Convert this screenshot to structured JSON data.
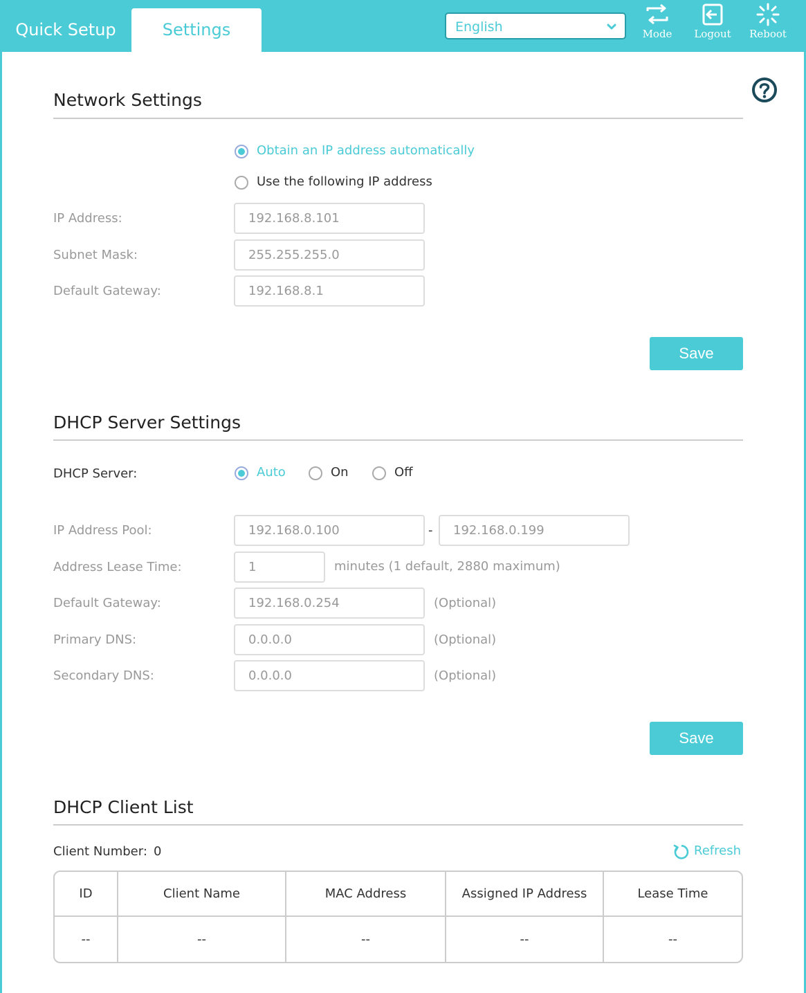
{
  "tabs": {
    "quick_setup": "Quick Setup",
    "settings": "Settings"
  },
  "language": {
    "selected": "English"
  },
  "toolbar": {
    "mode": "Mode",
    "logout": "Logout",
    "reboot": "Reboot"
  },
  "network": {
    "title": "Network Settings",
    "option_auto": "Obtain an IP address automatically",
    "option_manual": "Use the following IP address",
    "selected": "auto",
    "ip_label": "IP Address:",
    "ip_value": "192.168.8.101",
    "mask_label": "Subnet Mask:",
    "mask_value": "255.255.255.0",
    "gateway_label": "Default Gateway:",
    "gateway_value": "192.168.8.1",
    "save": "Save"
  },
  "dhcp": {
    "title": "DHCP Server Settings",
    "server_label": "DHCP Server:",
    "options": [
      "Auto",
      "On",
      "Off"
    ],
    "selected": "Auto",
    "pool_label": "IP Address Pool:",
    "pool_start": "192.168.0.100",
    "pool_sep": "-",
    "pool_end": "192.168.0.199",
    "lease_label": "Address Lease Time:",
    "lease_value": "1",
    "lease_hint": "minutes (1 default, 2880 maximum)",
    "gateway_label": "Default Gateway:",
    "gateway_value": "192.168.0.254",
    "primary_dns_label": "Primary DNS:",
    "primary_dns_value": "0.0.0.0",
    "secondary_dns_label": "Secondary DNS:",
    "secondary_dns_value": "0.0.0.0",
    "optional": "(Optional)",
    "save": "Save"
  },
  "clients": {
    "title": "DHCP Client List",
    "count_label": "Client Number:",
    "count": "0",
    "refresh": "Refresh",
    "columns": [
      "ID",
      "Client Name",
      "MAC Address",
      "Assigned IP Address",
      "Lease Time"
    ],
    "rows": [
      [
        "--",
        "--",
        "--",
        "--",
        "--"
      ]
    ]
  },
  "colors": {
    "accent": "#4acbd6",
    "accent_dark": "#2a9ea8",
    "muted": "#999999"
  }
}
